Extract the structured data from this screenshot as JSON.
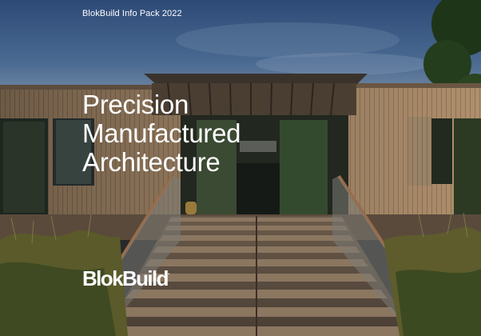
{
  "cover": {
    "pack_label": "BlokBuild Info Pack 2022",
    "headline": [
      "Precision",
      "Manufactured",
      "Architecture"
    ],
    "logo_text": "BlokBuild",
    "logo_mark": "."
  },
  "colors": {
    "text": "#ffffff",
    "sky": "#3f5f8c",
    "timber": "#8a7256",
    "greenery": "#4e5a2a"
  }
}
